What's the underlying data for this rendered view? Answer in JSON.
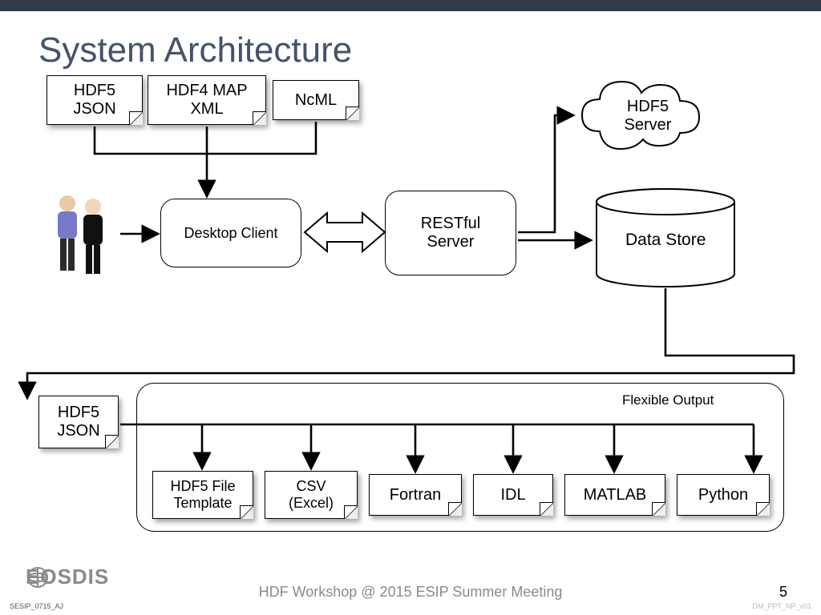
{
  "slide": {
    "title": "System Architecture",
    "inputs": {
      "hdf5json": "HDF5\nJSON",
      "hdf4map": "HDF4 MAP\nXML",
      "ncml": "NcML"
    },
    "client": "Desktop Client",
    "rest": "RESTful\nServer",
    "cloud": "HDF5\nServer",
    "store": "Data Store",
    "out_json": "HDF5\nJSON",
    "panel_label": "Flexible Output",
    "outputs": {
      "tpl": "HDF5 File\nTemplate",
      "csv": "CSV\n(Excel)",
      "fortran": "Fortran",
      "idl": "IDL",
      "matlab": "MATLAB",
      "python": "Python"
    }
  },
  "footer": {
    "caption": "HDF Workshop @ 2015 ESIP Summer Meeting",
    "page": "5",
    "logo": "EOSDIS",
    "code_left": "SESIP_0715_AJ",
    "code_right": "DM_PPT_NP_v01"
  }
}
